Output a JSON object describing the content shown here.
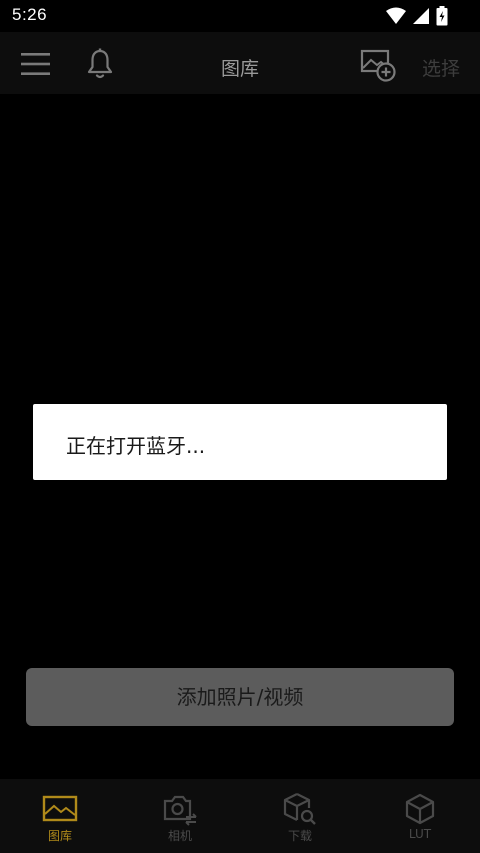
{
  "status_bar": {
    "time": "5:26",
    "icons": [
      "wifi-icon",
      "signal-icon",
      "battery-charging-icon"
    ]
  },
  "app_bar": {
    "title": "图库",
    "select_label": "选择",
    "icons": [
      "menu-icon",
      "bell-icon",
      "add-image-icon"
    ]
  },
  "dialog": {
    "message": "正在打开蓝牙..."
  },
  "main": {
    "add_button_label": "添加照片/视频"
  },
  "bottom_nav": {
    "items": [
      {
        "label": "图库",
        "icon": "gallery-icon",
        "active": true
      },
      {
        "label": "相机",
        "icon": "camera-switch-icon",
        "active": false
      },
      {
        "label": "下载",
        "icon": "box-search-icon",
        "active": false
      },
      {
        "label": "LUT",
        "icon": "cube-icon",
        "active": false
      }
    ]
  },
  "colors": {
    "background": "#000000",
    "bar_background": "#0d0d0d",
    "accent": "#b08a1a",
    "button_background": "#5c5c5c"
  }
}
